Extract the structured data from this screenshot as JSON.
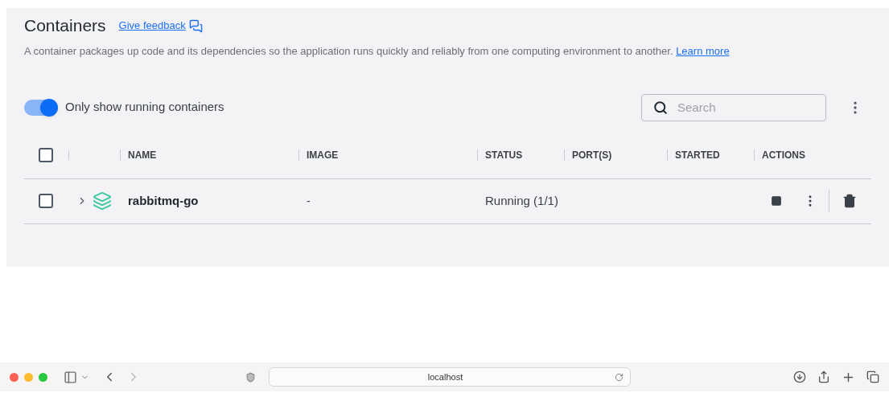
{
  "header": {
    "title": "Containers",
    "feedback_link": "Give feedback"
  },
  "description": {
    "text": "A container packages up code and its dependencies so the application runs quickly and reliably from one computing environment to another.",
    "link": "Learn more"
  },
  "toggle": {
    "label": "Only show running containers",
    "on": true
  },
  "search": {
    "placeholder": "Search"
  },
  "table": {
    "select_all": {
      "checked": false
    },
    "columns": [
      "NAME",
      "IMAGE",
      "STATUS",
      "PORT(S)",
      "STARTED",
      "ACTIONS"
    ],
    "rows": [
      {
        "checked": false,
        "expanded": false,
        "name": "rabbitmq-go",
        "image": "-",
        "status": "Running (1/1)"
      }
    ]
  },
  "browser": {
    "address": "localhost"
  }
}
